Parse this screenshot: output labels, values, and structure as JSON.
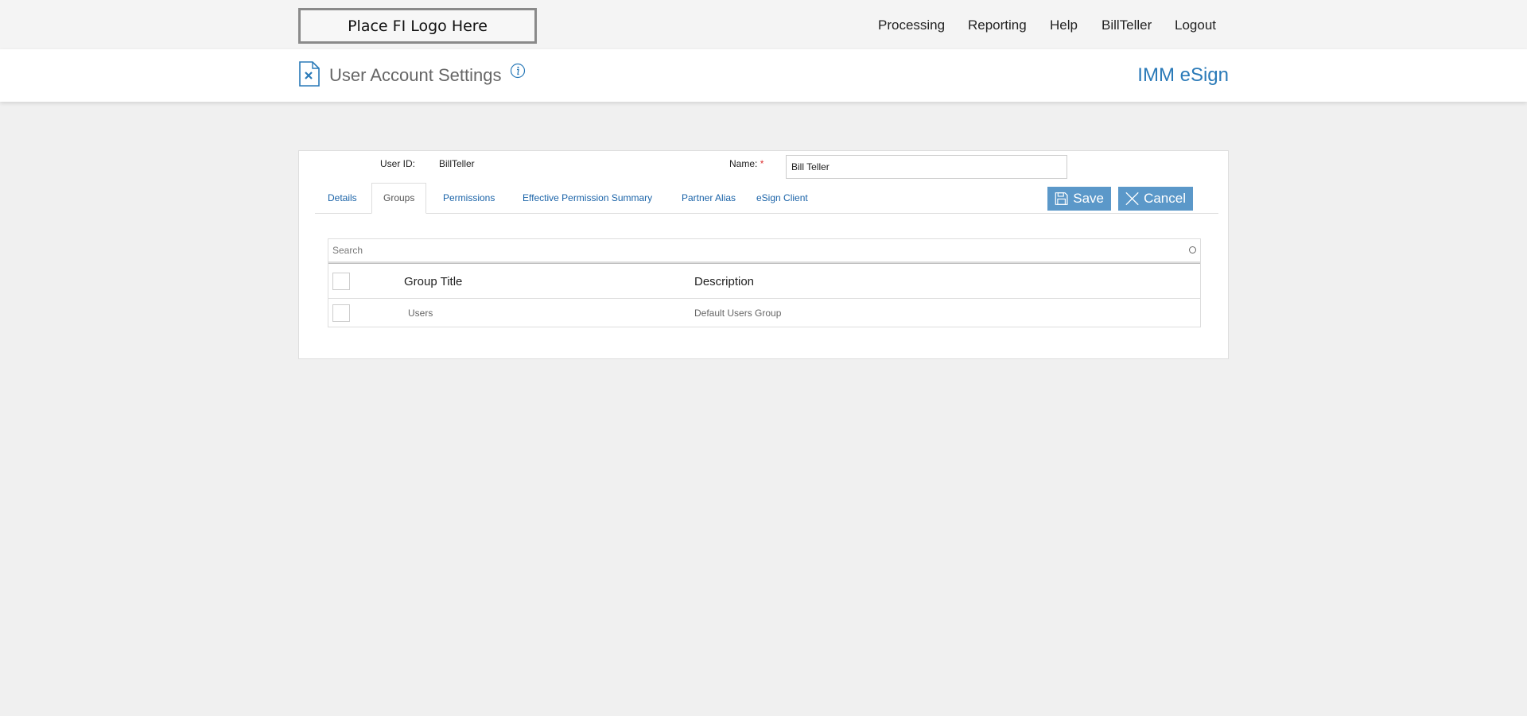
{
  "topbar": {
    "logo_text": "Place FI Logo Here",
    "nav": [
      "Processing",
      "Reporting",
      "Help",
      "BillTeller",
      "Logout"
    ]
  },
  "header": {
    "title": "User Account Settings",
    "brand": "IMM eSign",
    "icons": [
      "document-x-icon",
      "info-icon"
    ]
  },
  "user": {
    "id_label": "User ID:",
    "id_value": "BillTeller",
    "name_label": "Name:",
    "required_mark": "*",
    "name_value": "Bill Teller"
  },
  "tabs": [
    {
      "label": "Details",
      "active": false
    },
    {
      "label": "Groups",
      "active": true
    },
    {
      "label": "Permissions",
      "active": false
    },
    {
      "label": "Effective Permission Summary",
      "active": false
    },
    {
      "label": "Partner Alias",
      "active": false
    },
    {
      "label": "eSign Client",
      "active": false
    }
  ],
  "actions": {
    "save_label": "Save",
    "cancel_label": "Cancel"
  },
  "groups": {
    "search_placeholder": "Search",
    "columns": [
      "Group Title",
      "Description"
    ],
    "rows": [
      {
        "title": "Users",
        "description": "Default Users Group",
        "checked": false
      }
    ]
  },
  "colors": {
    "accent": "#2a7ab8",
    "button": "#5b98c9",
    "link": "#1a63a8",
    "required": "#dd3333"
  }
}
